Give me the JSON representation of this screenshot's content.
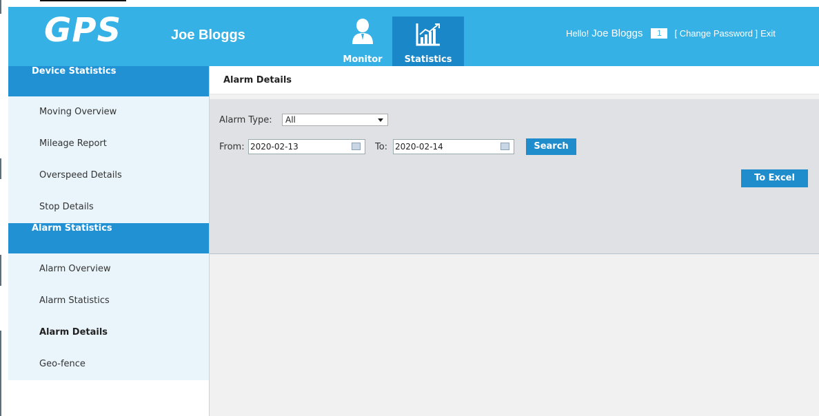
{
  "header": {
    "logo": "GPS",
    "user_display": "Joe Bloggs",
    "nav": [
      {
        "label": "Monitor",
        "icon": "user-icon"
      },
      {
        "label": "Statistics",
        "icon": "chart-icon"
      }
    ],
    "hello_prefix": "Hello!",
    "hello_name": "Joe Bloggs",
    "badge_count": "1",
    "change_password": "[ Change Password ]",
    "exit": "Exit"
  },
  "sidebar": {
    "device_heading": "Device Statistics",
    "device_items": [
      "Moving Overview",
      "Mileage Report",
      "Overspeed Details",
      "Stop Details"
    ],
    "alarm_heading": "Alarm Statistics",
    "alarm_items": [
      "Alarm Overview",
      "Alarm Statistics",
      "Alarm Details",
      "Geo-fence"
    ]
  },
  "main": {
    "title": "Alarm Details",
    "alarm_type_label": "Alarm Type:",
    "alarm_type_value": "All",
    "from_label": "From:",
    "from_value": "2020-02-13",
    "to_label": "To:",
    "to_value": "2020-02-14",
    "search_label": "Search",
    "excel_label": "To Excel"
  },
  "colors": {
    "header_bg": "#36b1e6",
    "accent": "#2191d3",
    "sidebar_item_bg": "#e9f5fb",
    "filter_bg": "#e0e1e5"
  }
}
